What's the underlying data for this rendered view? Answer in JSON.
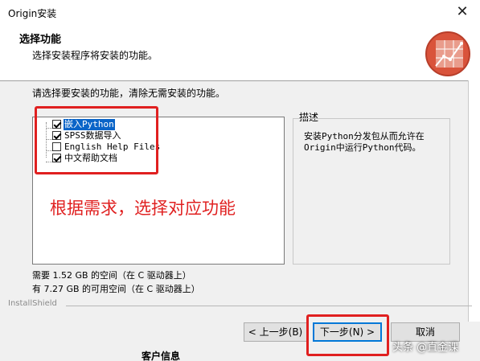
{
  "window": {
    "title": "Origin安装",
    "close_glyph": "✕"
  },
  "header": {
    "title": "选择功能",
    "subtitle": "选择安装程序将安装的功能。"
  },
  "instruction": "请选择要安装的功能，清除无需安装的功能。",
  "features": [
    {
      "label": "嵌入Python",
      "checked": true,
      "selected": true
    },
    {
      "label": "SPSS数据导入",
      "checked": true,
      "selected": false
    },
    {
      "label": "English Help Files",
      "checked": false,
      "selected": false
    },
    {
      "label": "中文帮助文档",
      "checked": true,
      "selected": false
    }
  ],
  "description": {
    "label": "描述",
    "text": "安装Python分发包从而允许在Origin中运行Python代码。"
  },
  "space": {
    "required": "需要 1.52 GB 的空间（在 C 驱动器上）",
    "available": "有 7.27 GB 的可用空间（在 C 驱动器上）"
  },
  "installshield": "InstallShield",
  "buttons": {
    "back": "< 上一步(B)",
    "next": "下一步(N) >",
    "cancel": "取消"
  },
  "annotation": "根据需求，选择对应功能",
  "watermark": "头条 @直金课",
  "cut_text": "客户信息",
  "colors": {
    "annotation": "#e02020",
    "selection": "#0a64c8",
    "default_button_border": "#0078d7"
  }
}
